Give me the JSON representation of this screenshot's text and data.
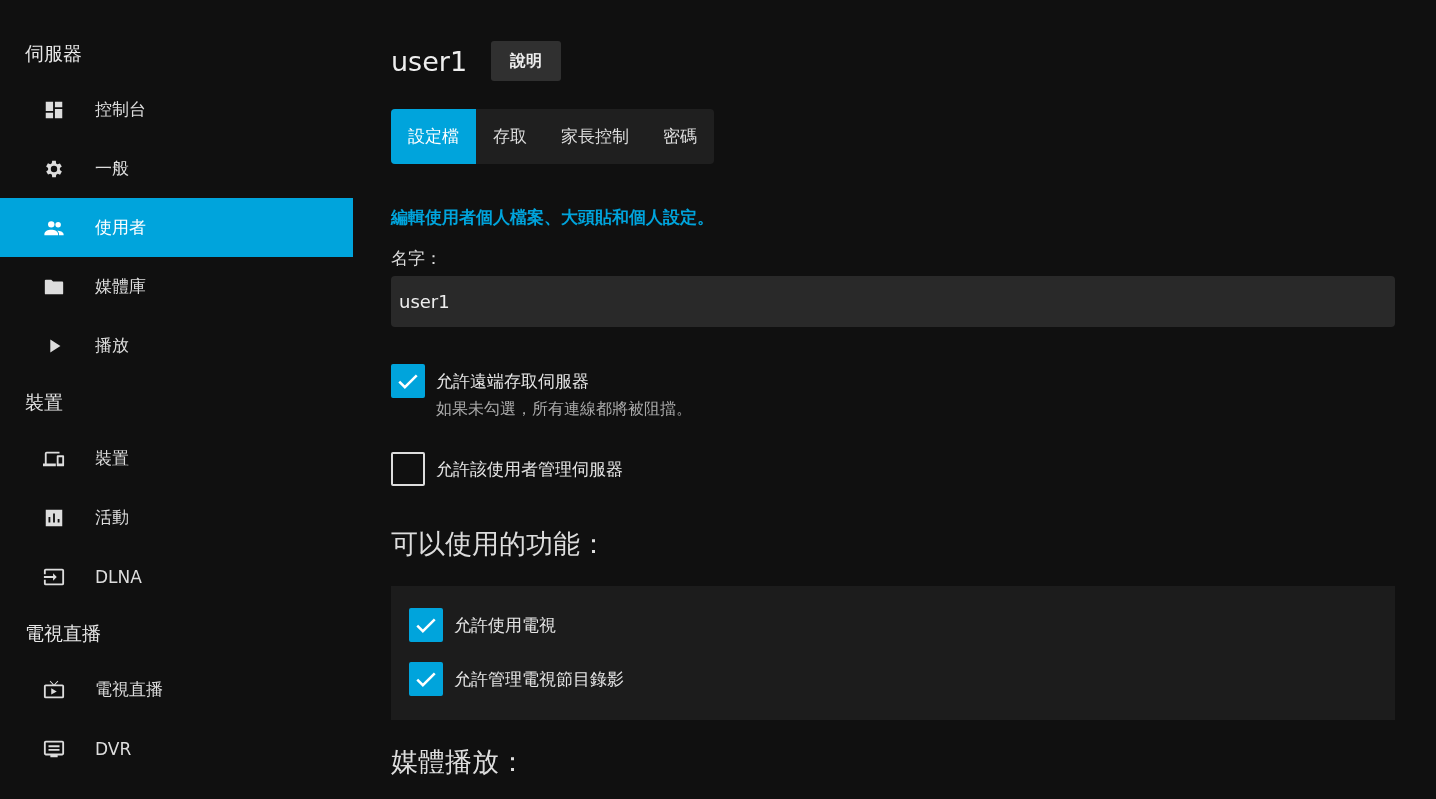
{
  "sidebar": {
    "sections": [
      {
        "title": "伺服器",
        "items": [
          {
            "label": "控制台",
            "kind": "dashboard",
            "selected": false
          },
          {
            "label": "一般",
            "kind": "gear",
            "selected": false
          },
          {
            "label": "使用者",
            "kind": "people",
            "selected": true
          },
          {
            "label": "媒體庫",
            "kind": "folder",
            "selected": false
          },
          {
            "label": "播放",
            "kind": "play",
            "selected": false
          }
        ]
      },
      {
        "title": "裝置",
        "items": [
          {
            "label": "裝置",
            "kind": "devices",
            "selected": false
          },
          {
            "label": "活動",
            "kind": "chart",
            "selected": false
          },
          {
            "label": "DLNA",
            "kind": "input",
            "selected": false
          }
        ]
      },
      {
        "title": "電視直播",
        "items": [
          {
            "label": "電視直播",
            "kind": "tv",
            "selected": false
          },
          {
            "label": "DVR",
            "kind": "dvr",
            "selected": false
          }
        ]
      }
    ]
  },
  "main": {
    "title": "user1",
    "help_button": "說明",
    "tabs": [
      {
        "label": "設定檔",
        "selected": true
      },
      {
        "label": "存取",
        "selected": false
      },
      {
        "label": "家長控制",
        "selected": false
      },
      {
        "label": "密碼",
        "selected": false
      }
    ],
    "heading": "編輯使用者個人檔案、大頭貼和個人設定。",
    "name_field": {
      "label": "名字：",
      "value": "user1"
    },
    "checkboxes": [
      {
        "label": "允許遠端存取伺服器",
        "checked": true,
        "hint": "如果未勾選，所有連線都將被阻擋。"
      },
      {
        "label": "允許該使用者管理伺服器",
        "checked": false
      }
    ],
    "features": {
      "title": "可以使用的功能：",
      "checkboxes": [
        {
          "label": "允許使用電視",
          "checked": true
        },
        {
          "label": "允許管理電視節目錄影",
          "checked": true
        }
      ]
    },
    "next_section_title": "媒體播放："
  }
}
